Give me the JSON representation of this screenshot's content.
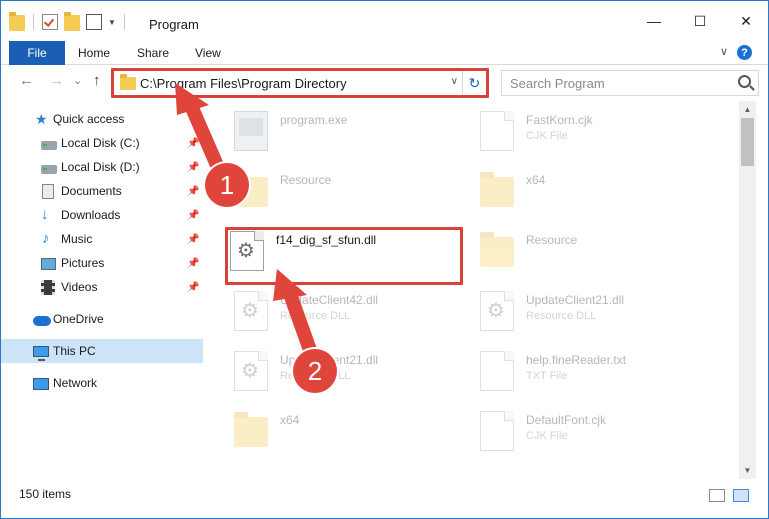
{
  "window": {
    "title": "Program",
    "minimize": "—",
    "maximize": "☐",
    "close": "✕"
  },
  "ribbon": {
    "tabs": [
      "File",
      "Home",
      "Share",
      "View"
    ],
    "help": "?"
  },
  "nav": {
    "back": "←",
    "forward": "→",
    "recent": "⌄",
    "up": "↑",
    "address": "C:\\Program Files\\Program Directory",
    "refresh": "↻",
    "search_placeholder": "Search Program"
  },
  "sidebar": {
    "items": [
      {
        "label": "Quick access",
        "icon": "star-icon",
        "pinned": false
      },
      {
        "label": "Local Disk (C:)",
        "icon": "drive-icon",
        "pinned": true
      },
      {
        "label": "Local Disk (D:)",
        "icon": "drive-icon",
        "pinned": true
      },
      {
        "label": "Documents",
        "icon": "documents-icon",
        "pinned": true
      },
      {
        "label": "Downloads",
        "icon": "download-icon",
        "pinned": true
      },
      {
        "label": "Music",
        "icon": "music-icon",
        "pinned": true
      },
      {
        "label": "Pictures",
        "icon": "pictures-icon",
        "pinned": true
      },
      {
        "label": "Videos",
        "icon": "videos-icon",
        "pinned": true
      },
      {
        "label": "OneDrive",
        "icon": "onedrive-icon",
        "pinned": false
      },
      {
        "label": "This PC",
        "icon": "this-pc-icon",
        "pinned": false,
        "selected": true
      },
      {
        "label": "Network",
        "icon": "network-icon",
        "pinned": false
      }
    ],
    "pin_glyph": "📌"
  },
  "files": [
    {
      "name": "program.exe",
      "type": "",
      "icon": "exe-icon",
      "faded": true
    },
    {
      "name": "FastKorn.cjk",
      "type": "CJK File",
      "icon": "file-icon",
      "faded": true
    },
    {
      "name": "Resource",
      "type": "",
      "icon": "folder-icon",
      "faded": true
    },
    {
      "name": "x64",
      "type": "",
      "icon": "folder-icon",
      "faded": true
    },
    {
      "name": "f14_dig_sf_sfun.dll",
      "type": "",
      "icon": "dll-icon",
      "faded": false
    },
    {
      "name": "Resource",
      "type": "",
      "icon": "folder-icon",
      "faded": true
    },
    {
      "name": "UpdateClient42.dll",
      "type": "Resource DLL",
      "icon": "dll-icon",
      "faded": true
    },
    {
      "name": "UpdateClient21.dll",
      "type": "Resource DLL",
      "icon": "dll-icon",
      "faded": true
    },
    {
      "name": "UpdateClient21.dll",
      "type": "Resource DLL",
      "icon": "dll-icon",
      "faded": true
    },
    {
      "name": "help.fineReader.txt",
      "type": "TXT File",
      "icon": "file-icon",
      "faded": true
    },
    {
      "name": "x64",
      "type": "",
      "icon": "folder-icon",
      "faded": true
    },
    {
      "name": "DefaultFont.cjk",
      "type": "CJK File",
      "icon": "file-icon",
      "faded": true
    }
  ],
  "status": {
    "count": "150 items"
  },
  "annotations": {
    "badge1": "1",
    "badge2": "2",
    "color": "#e0453c"
  },
  "colors": {
    "accent": "#1a5fb4",
    "selection": "#cde3f7",
    "highlight": "#d9423a"
  }
}
